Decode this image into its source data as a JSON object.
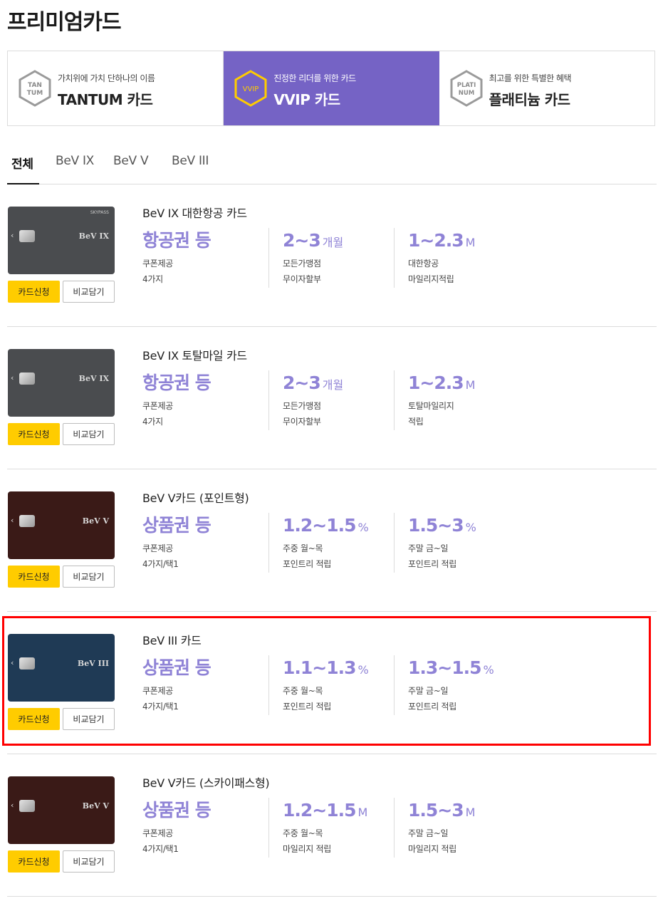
{
  "page_title": "프리미엄카드",
  "tiers": [
    {
      "hex_text_1": "TAN",
      "hex_text_2": "TUM",
      "subtitle": "가치위에 가치 단하나의 이름",
      "name": "TANTUM 카드"
    },
    {
      "hex_text_1": "VVIP",
      "hex_text_2": "",
      "subtitle": "진정한 리더를 위한 카드",
      "name": "VVIP 카드"
    },
    {
      "hex_text_1": "PLATI",
      "hex_text_2": "NUM",
      "subtitle": "최고를 위한 특별한 혜택",
      "name": "플래티늄 카드"
    }
  ],
  "tabs": [
    "전체",
    "BeV IX",
    "BeV V",
    "BeV III"
  ],
  "buttons": {
    "apply": "카드신청",
    "compare": "비교담기"
  },
  "cards": [
    {
      "title": "BeV IX 대한항공 카드",
      "card_brand": "BeV IX",
      "card_logo": "SKYPASS",
      "card_color": "#4a4c4f",
      "stats": [
        {
          "value": "항공권 등",
          "unit": "",
          "line1": "쿠폰제공",
          "line2": "4가지"
        },
        {
          "value": "2~3",
          "unit": "개월",
          "line1": "모든가맹점",
          "line2": "무이자할부"
        },
        {
          "value": "1~2.3",
          "unit": "M",
          "line1": "대한항공",
          "line2": "마일리지적립"
        }
      ]
    },
    {
      "title": "BeV IX 토탈마일 카드",
      "card_brand": "BeV IX",
      "card_logo": "",
      "card_color": "#4a4c4f",
      "stats": [
        {
          "value": "항공권 등",
          "unit": "",
          "line1": "쿠폰제공",
          "line2": "4가지"
        },
        {
          "value": "2~3",
          "unit": "개월",
          "line1": "모든가맹점",
          "line2": "무이자할부"
        },
        {
          "value": "1~2.3",
          "unit": "M",
          "line1": "토탈마일리지",
          "line2": "적립"
        }
      ]
    },
    {
      "title": "BeV V카드 (포인트형)",
      "card_brand": "BeV V",
      "card_logo": "",
      "card_color": "#3a1a17",
      "stats": [
        {
          "value": "상품권 등",
          "unit": "",
          "line1": "쿠폰제공",
          "line2": "4가지/택1"
        },
        {
          "value": "1.2~1.5",
          "unit": "%",
          "line1": "주중 월~목",
          "line2": "포인트리 적립"
        },
        {
          "value": "1.5~3",
          "unit": "%",
          "line1": "주말 금~일",
          "line2": "포인트리 적립"
        }
      ]
    },
    {
      "title": "BeV III 카드",
      "card_brand": "BeV III",
      "card_logo": "",
      "card_color": "#1f3a55",
      "stats": [
        {
          "value": "상품권 등",
          "unit": "",
          "line1": "쿠폰제공",
          "line2": "4가지/택1"
        },
        {
          "value": "1.1~1.3",
          "unit": "%",
          "line1": "주중 월~목",
          "line2": "포인트리 적립"
        },
        {
          "value": "1.3~1.5",
          "unit": "%",
          "line1": "주말 금~일",
          "line2": "포인트리 적립"
        }
      ]
    },
    {
      "title": "BeV V카드 (스카이패스형)",
      "card_brand": "BeV V",
      "card_logo": "",
      "card_color": "#3a1a17",
      "stats": [
        {
          "value": "상품권 등",
          "unit": "",
          "line1": "쿠폰제공",
          "line2": "4가지/택1"
        },
        {
          "value": "1.2~1.5",
          "unit": "M",
          "line1": "주중 월~목",
          "line2": "마일리지 적립"
        },
        {
          "value": "1.5~3",
          "unit": "M",
          "line1": "주말 금~일",
          "line2": "마일리지 적립"
        }
      ]
    }
  ],
  "colors": {
    "accent": "#7563c5",
    "stat_value": "#8f83d6",
    "apply_button": "#ffcc00",
    "highlight_border": "#ff0000"
  }
}
